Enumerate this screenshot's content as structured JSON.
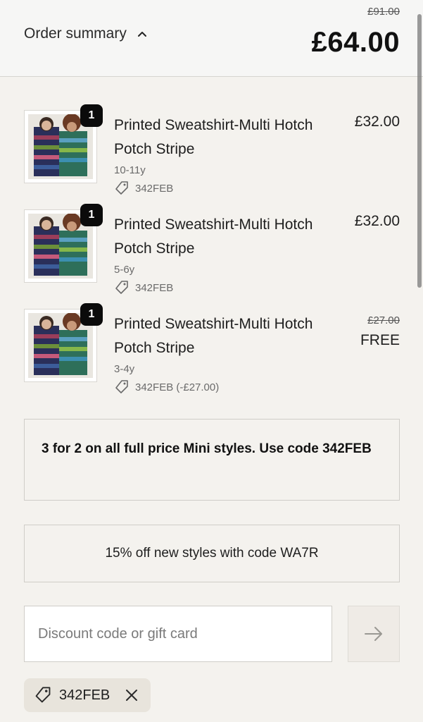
{
  "header": {
    "summary_label": "Order summary",
    "original_total": "£91.00",
    "total": "£64.00"
  },
  "items": [
    {
      "quantity": "1",
      "name": "Printed Sweatshirt-Multi Hotch Potch Stripe",
      "variant": "10-11y",
      "code": "342FEB",
      "price": "£32.00"
    },
    {
      "quantity": "1",
      "name": "Printed Sweatshirt-Multi Hotch Potch Stripe",
      "variant": "5-6y",
      "code": "342FEB",
      "price": "£32.00"
    },
    {
      "quantity": "1",
      "name": "Printed Sweatshirt-Multi Hotch Potch Stripe",
      "variant": "3-4y",
      "code": "342FEB (-£27.00)",
      "original_price": "£27.00",
      "price": "FREE"
    }
  ],
  "promos": {
    "promo1": "3 for 2 on all full price Mini styles. Use code 342FEB",
    "promo2": "15% off new styles with code WA7R"
  },
  "discount": {
    "placeholder": "Discount code or gift card",
    "value": ""
  },
  "applied_code": {
    "code": "342FEB"
  },
  "colors": {
    "background": "#f4f2ee",
    "header_bg": "#f6f6f5",
    "badge_bg": "#0b0b0b",
    "chip_bg": "#e8e4dc"
  },
  "icons": {
    "toggle": "chevron-up-icon",
    "tag": "tag-icon",
    "apply": "arrow-right-icon",
    "remove": "close-icon"
  }
}
